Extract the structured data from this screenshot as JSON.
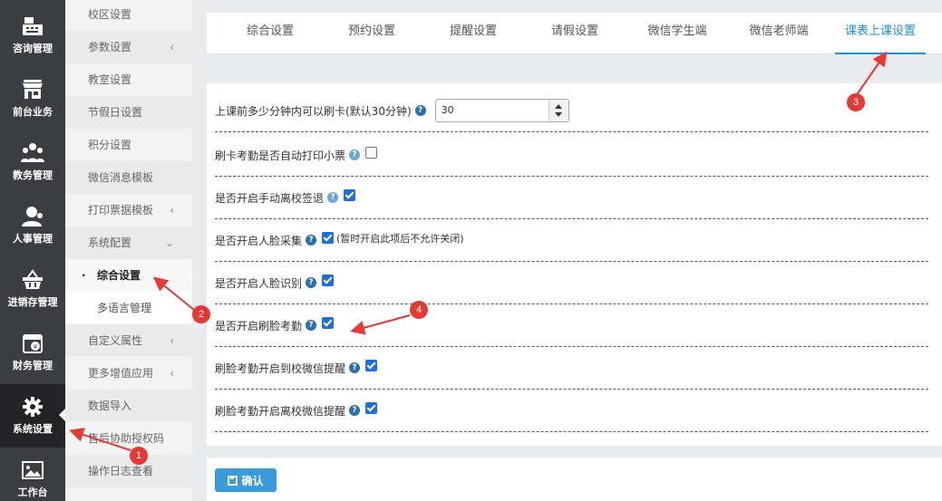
{
  "rail": {
    "items": [
      {
        "label": "咨询管理",
        "icon": "cash-register-icon"
      },
      {
        "label": "前台业务",
        "icon": "storefront-icon"
      },
      {
        "label": "教务管理",
        "icon": "people-group-icon"
      },
      {
        "label": "人事管理",
        "icon": "user-icon"
      },
      {
        "label": "进销存管理",
        "icon": "basket-icon"
      },
      {
        "label": "财务管理",
        "icon": "calendar-money-icon"
      },
      {
        "label": "系统设置",
        "icon": "gear-icon"
      },
      {
        "label": "工作台",
        "icon": "image-icon"
      }
    ]
  },
  "submenu": {
    "items": [
      {
        "label": "校区设置"
      },
      {
        "label": "参数设置"
      },
      {
        "label": "教室设置"
      },
      {
        "label": "节假日设置"
      },
      {
        "label": "积分设置"
      },
      {
        "label": "微信消息模板"
      },
      {
        "label": "打印票据模板"
      },
      {
        "label": "系统配置"
      },
      {
        "label": "综合设置"
      },
      {
        "label": "多语言管理"
      },
      {
        "label": "自定义属性"
      },
      {
        "label": "更多增值应用"
      },
      {
        "label": "数据导入"
      },
      {
        "label": "售后协助授权码"
      },
      {
        "label": "操作日志查看"
      }
    ],
    "active_dot": "·"
  },
  "tabs": [
    {
      "label": "综合设置"
    },
    {
      "label": "预约设置"
    },
    {
      "label": "提醒设置"
    },
    {
      "label": "请假设置"
    },
    {
      "label": "微信学生端"
    },
    {
      "label": "微信老师端"
    },
    {
      "label": "课表上课设置"
    }
  ],
  "settings": {
    "swipe_minutes": {
      "label": "上课前多少分钟内可以刷卡(默认30分钟)",
      "value": "30"
    },
    "print_receipt": {
      "label": "刷卡考勤是否自动打印小票",
      "checked": false
    },
    "manual_signout": {
      "label": "是否开启手动离校签退",
      "checked": true
    },
    "face_collect": {
      "label": "是否开启人脸采集",
      "checked": true,
      "note": "(暂时开启此项后不允许关闭)"
    },
    "face_recog": {
      "label": "是否开启人脸识别",
      "checked": true
    },
    "face_attendance": {
      "label": "是否开启刷脸考勤",
      "checked": true
    },
    "arrive_wechat": {
      "label": "刷脸考勤开启到校微信提醒",
      "checked": true
    },
    "leave_wechat": {
      "label": "刷脸考勤开启离校微信提醒",
      "checked": true
    }
  },
  "help_glyph": "?",
  "footer": {
    "confirm_label": "确认"
  },
  "annotations": {
    "badges": [
      "1",
      "2",
      "3",
      "4"
    ],
    "color": "#e53935"
  },
  "colors": {
    "accent": "#1e90d6",
    "rail": "#3a3d42",
    "button": "#3a9bdc"
  }
}
